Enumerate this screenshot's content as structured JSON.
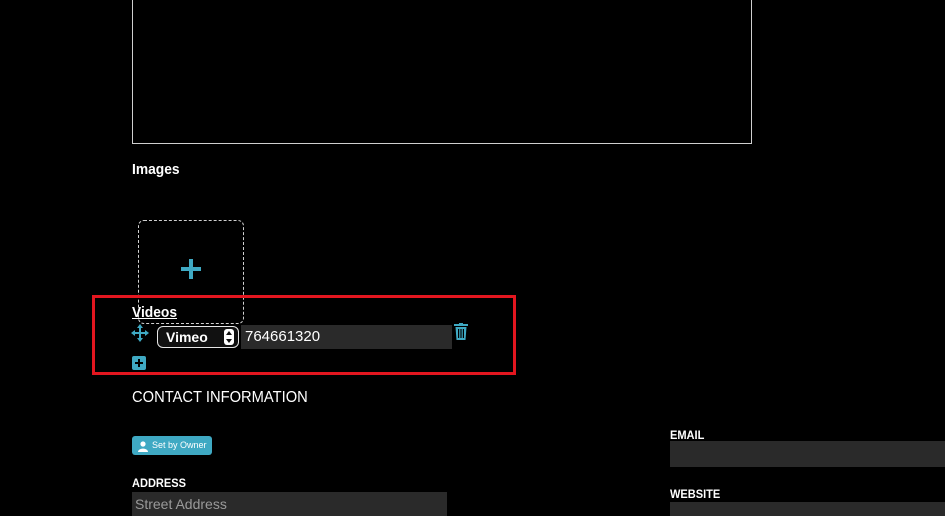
{
  "images": {
    "label": "Images"
  },
  "videos": {
    "label": "Videos",
    "entries": [
      {
        "provider": "Vimeo",
        "video_id": "764661320"
      }
    ]
  },
  "contact": {
    "heading": "CONTACT INFORMATION",
    "set_by_owner_label": "Set by Owner",
    "address_label": "ADDRESS",
    "street_placeholder": "Street Address",
    "email_label": "EMAIL",
    "website_label": "WEBSITE"
  },
  "colors": {
    "accent": "#3fa9c3",
    "highlight": "#e3161f",
    "background": "#000000",
    "field_bg": "#2a2a2a"
  },
  "icons": [
    "move-icon",
    "trash-icon",
    "add-icon",
    "plus-icon",
    "user-icon"
  ]
}
